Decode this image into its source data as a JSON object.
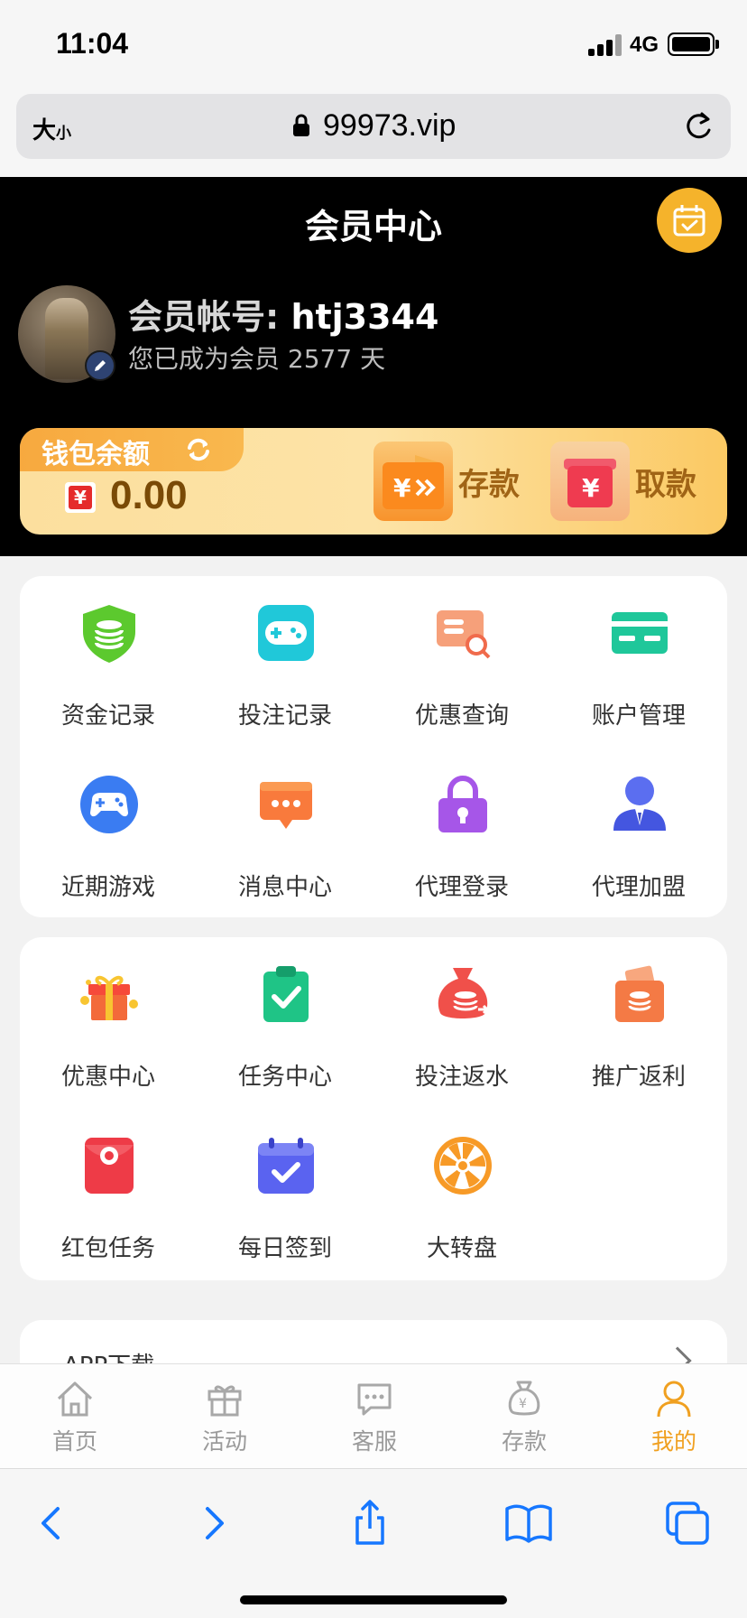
{
  "status_bar": {
    "time": "11:04",
    "network": "4G"
  },
  "browser": {
    "text_size": "大",
    "text_size_small": "小",
    "url": "99973.vip"
  },
  "header": {
    "title": "会员中心",
    "account_label": "会员帐号:",
    "account": "htj3344",
    "member_prefix": "您已成为会员",
    "member_days": "2577",
    "member_suffix": "天"
  },
  "wallet": {
    "label": "钱包余额",
    "currency_symbol": "¥",
    "amount": "0.00",
    "deposit_label": "存款",
    "withdraw_label": "取款"
  },
  "menu_primary": [
    {
      "label": "资金记录",
      "icon": "shield-coins-icon"
    },
    {
      "label": "投注记录",
      "icon": "gamepad-icon"
    },
    {
      "label": "优惠查询",
      "icon": "coupon-search-icon"
    },
    {
      "label": "账户管理",
      "icon": "card-icon"
    },
    {
      "label": "近期游戏",
      "icon": "controller-icon"
    },
    {
      "label": "消息中心",
      "icon": "message-icon"
    },
    {
      "label": "代理登录",
      "icon": "lock-icon"
    },
    {
      "label": "代理加盟",
      "icon": "agent-icon"
    }
  ],
  "menu_secondary": [
    {
      "label": "优惠中心",
      "icon": "gift-icon"
    },
    {
      "label": "任务中心",
      "icon": "clipboard-check-icon"
    },
    {
      "label": "投注返水",
      "icon": "money-bag-icon"
    },
    {
      "label": "推广返利",
      "icon": "bag-coins-icon"
    },
    {
      "label": "红包任务",
      "icon": "red-envelope-icon"
    },
    {
      "label": "每日签到",
      "icon": "calendar-check-icon"
    },
    {
      "label": "大转盘",
      "icon": "wheel-icon"
    }
  ],
  "app_download": {
    "label": "APP下载"
  },
  "tabs": [
    {
      "label": "首页",
      "icon": "home-icon"
    },
    {
      "label": "活动",
      "icon": "gift-icon"
    },
    {
      "label": "客服",
      "icon": "chat-icon"
    },
    {
      "label": "存款",
      "icon": "money-bag-icon"
    },
    {
      "label": "我的",
      "icon": "user-icon",
      "active": true
    }
  ],
  "colors": {
    "accent": "#f0a020",
    "header_bg": "#000000",
    "wallet_text": "#7a4a06"
  }
}
